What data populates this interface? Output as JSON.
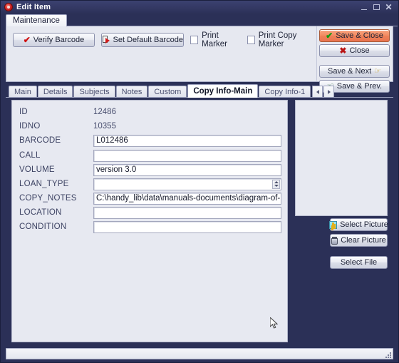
{
  "window": {
    "title": "Edit Item",
    "icon": "app-icon",
    "controls": {
      "minimize": "minimize-icon",
      "maximize": "maximize-icon",
      "close": "close-icon"
    }
  },
  "page_tab": {
    "label": "Maintenance"
  },
  "toolbar": {
    "verify_barcode": "Verify Barcode",
    "verify_icon": "red-check-icon",
    "set_default_barcode": "Set Default Barcode",
    "set_default_icon": "page-arrow-icon",
    "print_marker": {
      "label": "Print Marker",
      "checked": false
    },
    "print_copy_marker": {
      "label": "Print Copy Marker",
      "checked": false
    }
  },
  "actions": {
    "save_close": "Save & Close",
    "save_close_icon": "green-check-icon",
    "close": "Close",
    "close_icon": "red-x-icon",
    "save_next": "Save & Next",
    "save_next_icon": "hand-right-icon",
    "save_prev": "Save & Prev.",
    "save_prev_icon": "hand-left-icon"
  },
  "tabs": {
    "items": [
      {
        "label": "Main",
        "active": false
      },
      {
        "label": "Details",
        "active": false
      },
      {
        "label": "Subjects",
        "active": false
      },
      {
        "label": "Notes",
        "active": false
      },
      {
        "label": "Custom",
        "active": false
      },
      {
        "label": "Copy Info-Main",
        "active": true
      },
      {
        "label": "Copy Info-1",
        "active": false
      }
    ],
    "nav_prev": "tab-scroll-left-icon",
    "nav_next": "tab-scroll-right-icon"
  },
  "form": {
    "fields": [
      {
        "label": "ID",
        "value": "12486",
        "type": "static"
      },
      {
        "label": "IDNO",
        "value": "10355",
        "type": "static"
      },
      {
        "label": "BARCODE",
        "value": "L012486",
        "type": "input"
      },
      {
        "label": "CALL",
        "value": "",
        "type": "input"
      },
      {
        "label": "VOLUME",
        "value": "version 3.0",
        "type": "input"
      },
      {
        "label": "LOAN_TYPE",
        "value": "",
        "type": "spinner"
      },
      {
        "label": "COPY_NOTES",
        "value": "C:\\handy_lib\\data\\manuals-documents\\diagram-of-po",
        "type": "input"
      },
      {
        "label": "LOCATION",
        "value": "",
        "type": "input"
      },
      {
        "label": "CONDITION",
        "value": "",
        "type": "input"
      }
    ]
  },
  "picture": {
    "preview_alt": "picture-preview-empty",
    "select_picture": "Select Picture",
    "select_picture_icon": "person-icon",
    "clear_picture": "Clear Picture",
    "clear_picture_icon": "trash-icon",
    "select_file": "Select File"
  },
  "statusbar": {
    "text": "",
    "grip": "resize-grip-icon"
  },
  "colors": {
    "frame": "#2b3057",
    "titlebar_text": "#ffffff",
    "accent_save": "#ee8158",
    "panel": "#e7e9f1",
    "field_bg": "#ffffff",
    "label_text": "#3d4363"
  }
}
